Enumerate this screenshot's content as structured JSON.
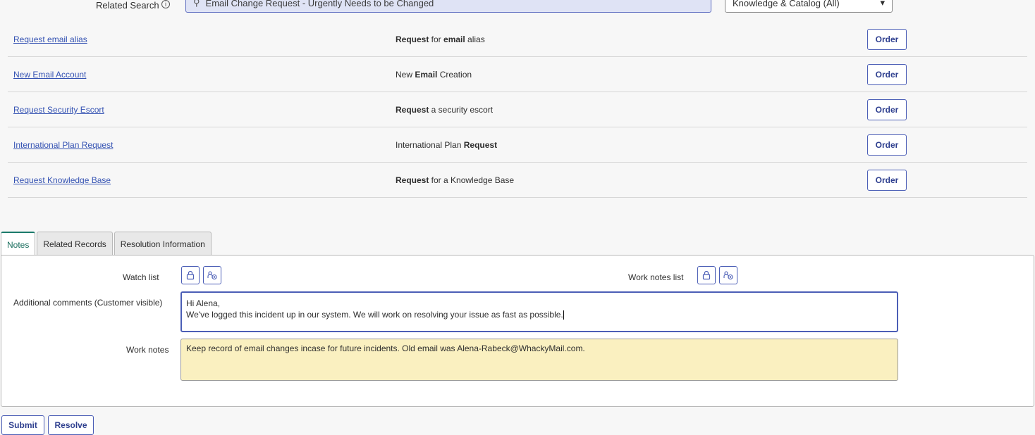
{
  "related_search": {
    "label": "Related Search",
    "help_icon": "info-icon",
    "query": "Email Change Request - Urgently Needs to be Changed",
    "scope": "Knowledge & Catalog (All)"
  },
  "results": [
    {
      "link": "Request email alias",
      "desc_parts": [
        {
          "t": "Request",
          "b": true
        },
        {
          "t": " for ",
          "b": false
        },
        {
          "t": "email",
          "b": true
        },
        {
          "t": " alias",
          "b": false
        }
      ],
      "action": "Order"
    },
    {
      "link": "New Email Account",
      "desc_parts": [
        {
          "t": "New ",
          "b": false
        },
        {
          "t": "Email",
          "b": true
        },
        {
          "t": " Creation",
          "b": false
        }
      ],
      "action": "Order"
    },
    {
      "link": "Request Security Escort",
      "desc_parts": [
        {
          "t": "Request",
          "b": true
        },
        {
          "t": " a security escort",
          "b": false
        }
      ],
      "action": "Order"
    },
    {
      "link": "International Plan Request",
      "desc_parts": [
        {
          "t": "International Plan ",
          "b": false
        },
        {
          "t": "Request",
          "b": true
        }
      ],
      "action": "Order"
    },
    {
      "link": "Request Knowledge Base",
      "desc_parts": [
        {
          "t": "Request",
          "b": true
        },
        {
          "t": " for a Knowledge Base",
          "b": false
        }
      ],
      "action": "Order"
    }
  ],
  "tabs": [
    {
      "label": "Notes",
      "active": true
    },
    {
      "label": "Related Records",
      "active": false
    },
    {
      "label": "Resolution Information",
      "active": false
    }
  ],
  "notes": {
    "watch_list_label": "Watch list",
    "work_notes_list_label": "Work notes list",
    "additional_comments_label": "Additional comments (Customer visible)",
    "additional_comments_lines": [
      "Hi Alena,",
      "We've logged this incident up in our system. We will work on resolving your issue as fast as possible."
    ],
    "work_notes_label": "Work notes",
    "work_notes_value": "Keep record of email changes incase for future incidents. Old email was Alena-Rabeck@WhackyMail.com."
  },
  "actions": {
    "submit": "Submit",
    "resolve": "Resolve"
  }
}
